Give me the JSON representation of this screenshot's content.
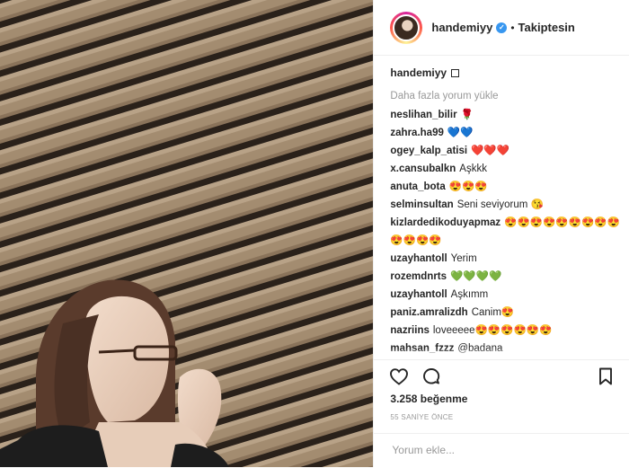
{
  "header": {
    "username": "handemiyy",
    "separator": "•",
    "follow_label": "Takiptesin",
    "verified_mark": "✓"
  },
  "caption": {
    "username": "handemiyy"
  },
  "load_more_label": "Daha fazla yorum yükle",
  "comments": [
    {
      "user": "neslihan_bilir",
      "text": "🌹"
    },
    {
      "user": "zahra.ha99",
      "text": "💙💙"
    },
    {
      "user": "ogey_kalp_atisi",
      "text": "❤️❤️❤️"
    },
    {
      "user": "x.cansubalkn",
      "text": "Aşkkk"
    },
    {
      "user": "anuta_bota",
      "text": "😍😍😍"
    },
    {
      "user": "selminsultan",
      "text": "Seni seviyorum 😘"
    },
    {
      "user": "kizlardedikoduyapmaz",
      "text": "😍😍😍😍😍😍😍😍😍😍😍😍😍"
    },
    {
      "user": "uzayhantoll",
      "text": "Yerim"
    },
    {
      "user": "rozemdnrts",
      "text": "💚💚💚💚"
    },
    {
      "user": "uzayhantoll",
      "text": "Aşkımm"
    },
    {
      "user": "paniz.amralizdh",
      "text": "Canim😍"
    },
    {
      "user": "nazriins",
      "text": "loveeeee😍😍😍😍😍😍"
    },
    {
      "user": "mahsan_fzzz",
      "text": "@badana"
    }
  ],
  "likes": "3.258 beğenme",
  "time_ago": "55 SANİYE ÖNCE",
  "add_comment_placeholder": "Yorum ekle...",
  "icons": {
    "like": "heart-icon",
    "comment": "comment-bubble-icon",
    "save": "bookmark-icon"
  }
}
